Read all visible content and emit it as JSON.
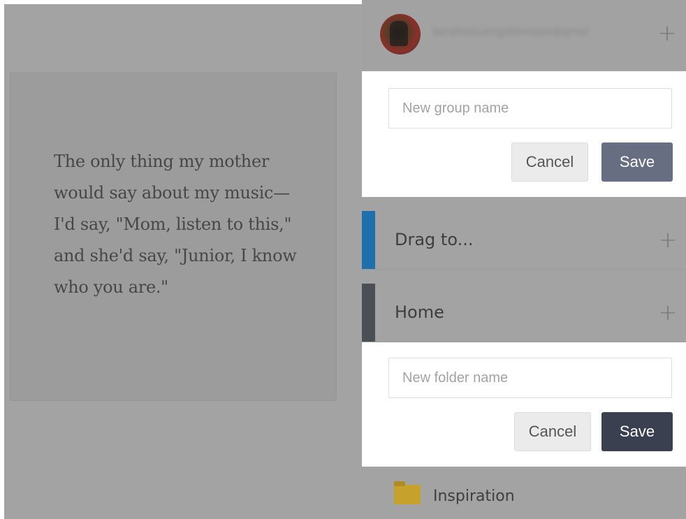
{
  "quote": {
    "text": "The only thing my mother would say about my music—I'd say, \"Mom, listen to this,\" and she'd say, \"Junior, I know who you are.\""
  },
  "account": {
    "email": "kerahelsuengsbomaye@gmai",
    "add_icon": "plus-icon"
  },
  "group_form": {
    "placeholder": "New group name",
    "cancel_label": "Cancel",
    "save_label": "Save"
  },
  "groups": [
    {
      "label": "Drag to...",
      "accent": "#1f6fad",
      "add_icon": "plus-icon"
    },
    {
      "label": "Home",
      "accent": "#494f55",
      "add_icon": "plus-icon"
    }
  ],
  "folder_form": {
    "placeholder": "New folder name",
    "cancel_label": "Cancel",
    "save_label": "Save"
  },
  "folders": [
    {
      "label": "Inspiration",
      "icon": "folder-icon",
      "color": "#c6a12b"
    }
  ],
  "colors": {
    "save_group_bg": "#676e82",
    "save_folder_bg": "#3a4050",
    "overlay": "#a3a3a3"
  }
}
